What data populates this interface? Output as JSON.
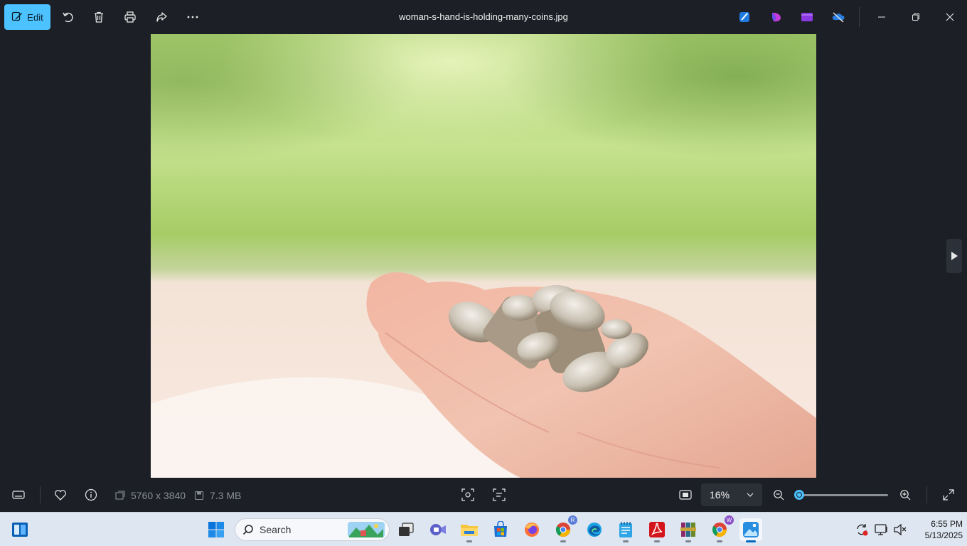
{
  "toolbar": {
    "edit_label": "Edit",
    "title": "woman-s-hand-is-holding-many-coins.jpg"
  },
  "info": {
    "dimensions": "5760 x 3840",
    "file_size": "7.3 MB"
  },
  "zoom": {
    "level_label": "16%",
    "slider_fraction": 0.03
  },
  "taskbar": {
    "search_placeholder": "Search",
    "time": "6:55 PM",
    "date": "5/13/2025"
  },
  "colors": {
    "accent": "#4cc2ff",
    "app_bg": "#1c2026",
    "taskbar_bg": "#dde6f1"
  }
}
